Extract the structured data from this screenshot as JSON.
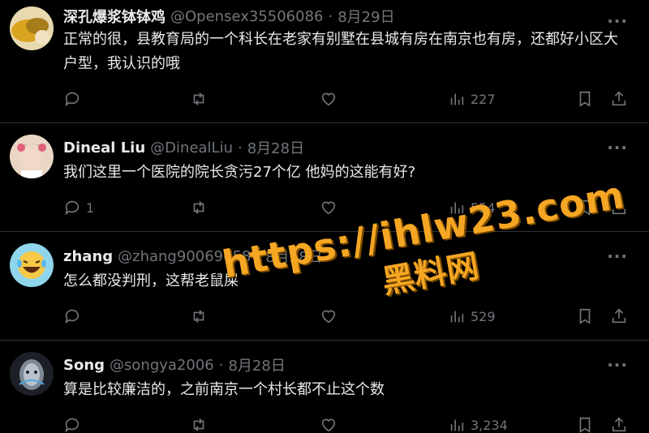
{
  "tweets": [
    {
      "name": "深孔爆浆钵钵鸡",
      "handle": "@Opensex35506086",
      "date": "8月29日",
      "text": "正常的很，县教育局的一个科长在老家有别墅在县城有房在南京也有房，还都好小区大户型，我认识的哦",
      "replies": "",
      "retweets": "",
      "likes": "",
      "views": "227",
      "avatar_color": "#c9a227"
    },
    {
      "name": "Dineal Liu",
      "handle": "@DinealLiu",
      "date": "8月28日",
      "text": "我们这里一个医院的院长贪污27个亿 他妈的这能有好?",
      "replies": "1",
      "retweets": "",
      "likes": "",
      "views": "554",
      "avatar_color": "#d8a9a0"
    },
    {
      "name": "zhang",
      "handle": "@zhang90069658",
      "date": "8月28日",
      "text": "怎么都没判刑，这帮老鼠屎",
      "replies": "",
      "retweets": "",
      "likes": "",
      "views": "529",
      "avatar_color": "#7fd0e8"
    },
    {
      "name": "Song",
      "handle": "@songya2006",
      "date": "8月28日",
      "text": "算是比较廉洁的，之前南京一个村长都不止这个数",
      "replies": "",
      "retweets": "",
      "likes": "",
      "views": "3,234",
      "avatar_color": "#3a3f46"
    }
  ],
  "separator": "·",
  "more_label": "···",
  "watermark": {
    "url": "https://ihlw23.com",
    "site": "黑料网"
  },
  "colors": {
    "background": "#000000",
    "text": "#e7e9ea",
    "muted": "#71767b",
    "divider": "#2f3336",
    "watermark": "#f5a623"
  }
}
